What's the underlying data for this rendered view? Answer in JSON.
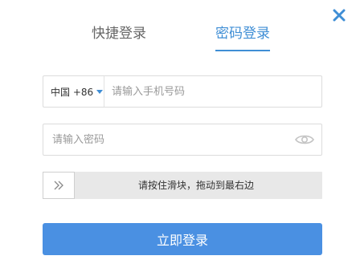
{
  "icons": {
    "close": "close-icon",
    "eye": "eye-icon",
    "slider_arrow": "double-chevron-right-icon",
    "country_caret": "caret-down-icon"
  },
  "colors": {
    "accent": "#3f8ed5",
    "button": "#4a90e2",
    "close": "#3f8ed5",
    "border": "#dcdcdc",
    "slider_track": "#e8e8e8"
  },
  "tabs": [
    {
      "label": "快捷登录",
      "active": false
    },
    {
      "label": "密码登录",
      "active": true
    }
  ],
  "phone": {
    "country_code": "中国 +86",
    "value": "",
    "placeholder": "请输入手机号码"
  },
  "password": {
    "value": "",
    "placeholder": "请输入密码"
  },
  "slider": {
    "text": "请按住滑块，拖动到最右边",
    "progress": 0
  },
  "login_button": {
    "label": "立即登录"
  }
}
